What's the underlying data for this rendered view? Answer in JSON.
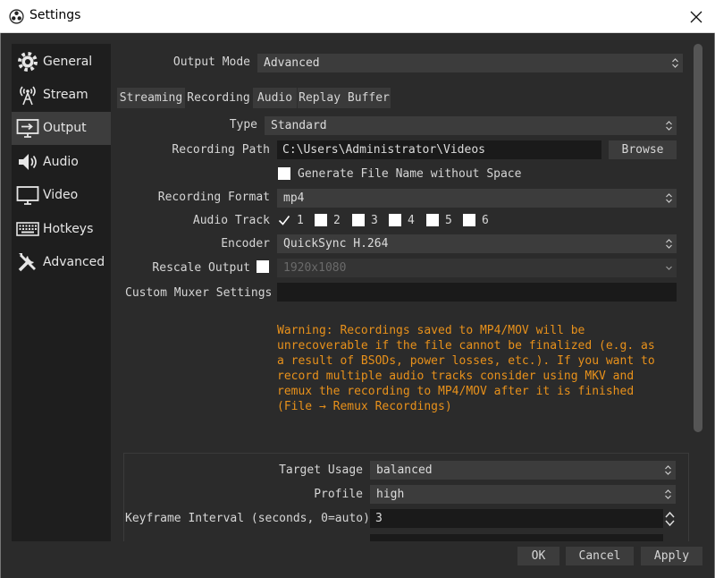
{
  "window": {
    "title": "Settings"
  },
  "sidebar": {
    "items": [
      {
        "label": "General",
        "icon": "gear-icon"
      },
      {
        "label": "Stream",
        "icon": "antenna-icon"
      },
      {
        "label": "Output",
        "icon": "monitor-arrow-icon"
      },
      {
        "label": "Audio",
        "icon": "speaker-icon"
      },
      {
        "label": "Video",
        "icon": "monitor-icon"
      },
      {
        "label": "Hotkeys",
        "icon": "keyboard-icon"
      },
      {
        "label": "Advanced",
        "icon": "tools-icon"
      }
    ],
    "selected": "Output"
  },
  "output_mode": {
    "label": "Output Mode",
    "value": "Advanced"
  },
  "tabs": [
    {
      "label": "Streaming"
    },
    {
      "label": "Recording"
    },
    {
      "label": "Audio"
    },
    {
      "label": "Replay Buffer"
    }
  ],
  "active_tab": "Recording",
  "recording": {
    "type": {
      "label": "Type",
      "value": "Standard"
    },
    "path": {
      "label": "Recording Path",
      "value": "C:\\Users\\Administrator\\Videos",
      "browse_label": "Browse"
    },
    "filename_option": {
      "label": "Generate File Name without Space",
      "checked": false
    },
    "format": {
      "label": "Recording Format",
      "value": "mp4"
    },
    "audio_track": {
      "label": "Audio Track",
      "tracks": [
        {
          "label": "1",
          "checked": true
        },
        {
          "label": "2",
          "checked": false
        },
        {
          "label": "3",
          "checked": false
        },
        {
          "label": "4",
          "checked": false
        },
        {
          "label": "5",
          "checked": false
        },
        {
          "label": "6",
          "checked": false
        }
      ]
    },
    "encoder": {
      "label": "Encoder",
      "value": "QuickSync H.264"
    },
    "rescale": {
      "label": "Rescale Output",
      "checked": false,
      "value": "1920x1080"
    },
    "muxer": {
      "label": "Custom Muxer Settings",
      "value": ""
    },
    "warning": "Warning: Recordings saved to MP4/MOV will be\nunrecoverable if the file cannot be finalized (e.g. as\na result of BSODs, power losses, etc.). If you want to\nrecord multiple audio tracks consider using MKV and\nremux the recording to MP4/MOV after it is finished\n(File → Remux Recordings)",
    "warning_color": "#e8911b"
  },
  "encoder_settings": {
    "target_usage": {
      "label": "Target Usage",
      "value": "balanced"
    },
    "profile": {
      "label": "Profile",
      "value": "high"
    },
    "keyframe": {
      "label": "Keyframe Interval (seconds, 0=auto)",
      "value": "3"
    }
  },
  "buttons": {
    "ok": "OK",
    "cancel": "Cancel",
    "apply": "Apply"
  }
}
